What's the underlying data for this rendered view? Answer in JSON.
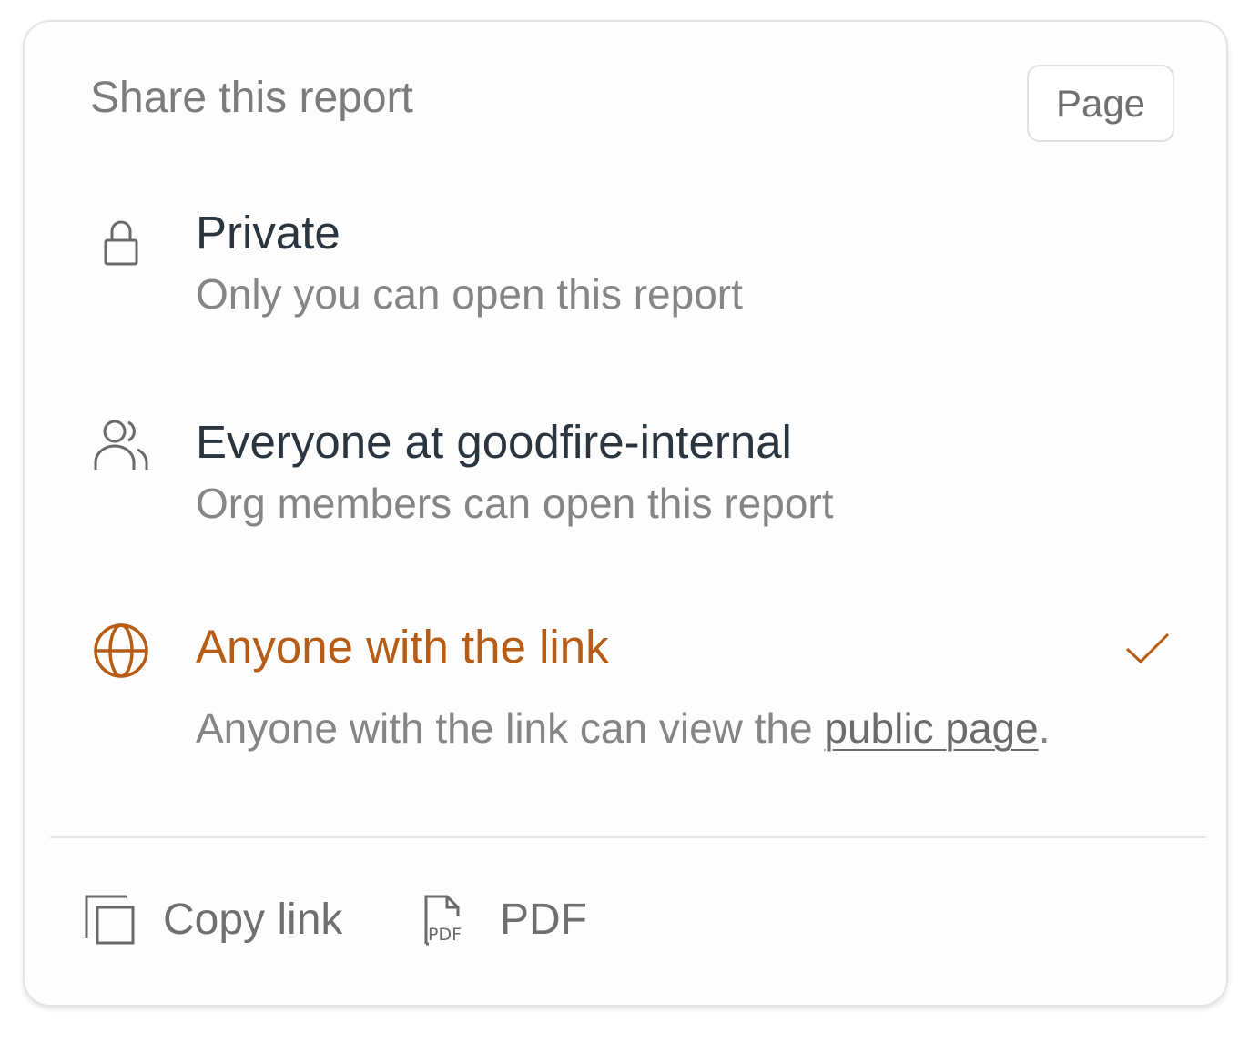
{
  "header": {
    "title": "Share this report",
    "page_button_label": "Page"
  },
  "options": [
    {
      "icon": "lock-icon",
      "title": "Private",
      "description": "Only you can open this report",
      "selected": false
    },
    {
      "icon": "users-icon",
      "title": "Everyone at goodfire-internal",
      "description": "Org members can open this report",
      "selected": false
    },
    {
      "icon": "globe-icon",
      "title": "Anyone with the link",
      "description_prefix": "Anyone with the link can view the ",
      "description_link": "public page",
      "description_suffix": ".",
      "selected": true
    }
  ],
  "actions": {
    "copy_link_label": "Copy link",
    "pdf_label": "PDF",
    "pdf_icon_text": "PDF"
  },
  "colors": {
    "accent": "#b65c14",
    "title": "#2a3540",
    "muted": "#858585",
    "border": "#e4e4e4"
  }
}
